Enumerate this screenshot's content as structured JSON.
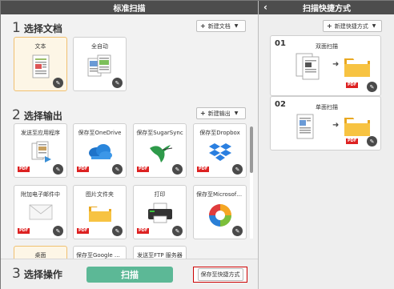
{
  "left_panel": {
    "title": "标准扫描",
    "section1": {
      "num": "1",
      "title": "选择文档",
      "new_button": "新建文档"
    },
    "documents": [
      {
        "label": "文本",
        "selected": true
      },
      {
        "label": "全自动",
        "selected": false
      }
    ],
    "section2": {
      "num": "2",
      "title": "选择输出",
      "new_button": "新建输出"
    },
    "outputs": [
      {
        "label": "发送至应用程序",
        "icon": "app-documents-icon",
        "pdf": "PDF"
      },
      {
        "label": "保存至OneDrive",
        "icon": "onedrive-cloud-icon",
        "pdf": "PDF"
      },
      {
        "label": "保存至SugarSync",
        "icon": "hummingbird-icon",
        "pdf": "PDF"
      },
      {
        "label": "保存至Dropbox",
        "icon": "dropbox-icon",
        "pdf": "PDF"
      },
      {
        "label": "附加电子邮件中",
        "icon": "envelope-icon",
        "pdf": "PDF"
      },
      {
        "label": "图片文件夹",
        "icon": "folder-icon",
        "pdf": "PDF"
      },
      {
        "label": "打印",
        "icon": "printer-icon",
        "pdf": "PDF"
      },
      {
        "label": "保存至Microsoft S...",
        "icon": "sharepoint-icon",
        "pdf": "PDF"
      }
    ],
    "partial_outputs": [
      "桌面",
      "保存至Google Drive",
      "发送至FTP 服务器"
    ],
    "section3": {
      "num": "3",
      "title": "选择操作"
    },
    "scan_button": "扫描",
    "save_shortcut_button": "保存至快捷方式"
  },
  "right_panel": {
    "title": "扫描快捷方式",
    "new_button": "新建快捷方式",
    "shortcuts": [
      {
        "num": "01",
        "label": "双面扫描",
        "pdf": "PDF"
      },
      {
        "num": "02",
        "label": "单面扫描",
        "pdf": "PDF"
      }
    ]
  },
  "colors": {
    "titlebar": "#4d4d4d",
    "scan_button": "#5cb896",
    "pdf_badge": "#dd2222",
    "selected_card": "#fdf6e6",
    "highlight_border": "#cc0000"
  }
}
